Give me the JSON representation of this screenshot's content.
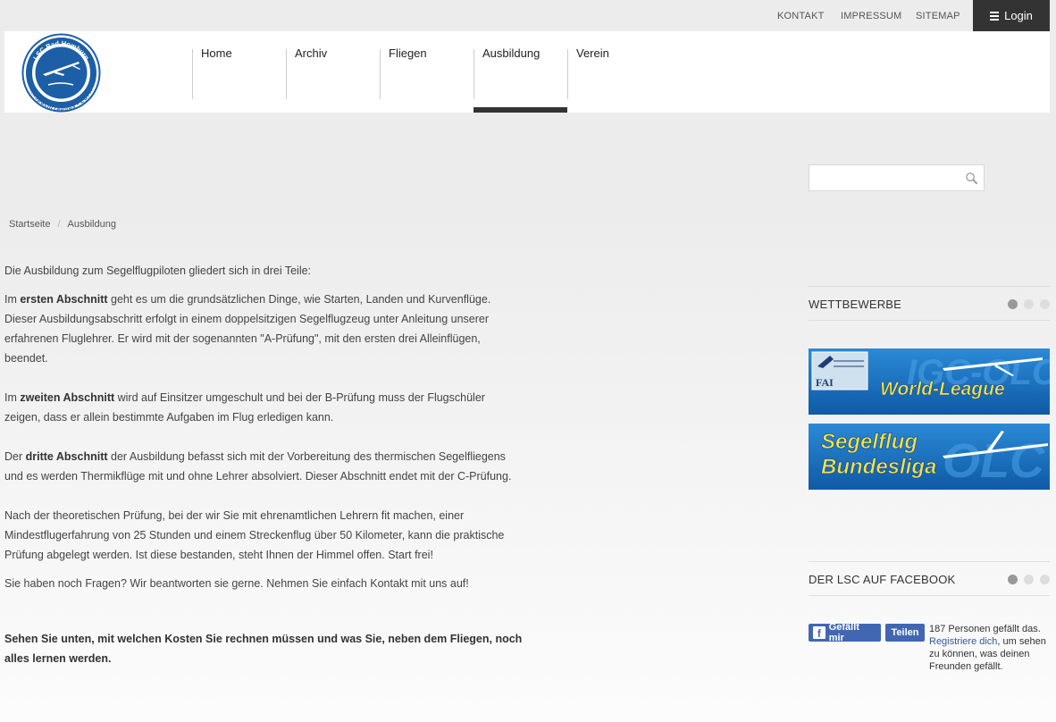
{
  "utility_links": [
    "KONTAKT",
    "IMPRESSUM",
    "SITEMAP"
  ],
  "login": {
    "label": "Login",
    "icon": "menu-icon"
  },
  "logo": {
    "top_text": "LSC Bad Homburg",
    "bottom_text": "Anspach/Taunus - EDFA",
    "icon": "glider-icon"
  },
  "nav": [
    "Home",
    "Archiv",
    "Fliegen",
    "Ausbildung",
    "Verein"
  ],
  "nav_active": "Ausbildung",
  "search": {
    "placeholder": "",
    "icon": "search-icon"
  },
  "breadcrumb": {
    "items": [
      "Startseite",
      "Ausbildung"
    ],
    "separator": "/"
  },
  "content": {
    "intro": "Die Ausbildung zum Segelflugpiloten gliedert sich in drei Teile:",
    "p1_a": "Im ",
    "p1_bold": "ersten Abschnitt",
    "p1_b": " geht es um die grundsätzlichen Dinge, wie Starten, Landen und Kurvenflüge. Dieser Ausbildungsabschritt erfolgt in einem doppelsitzigen Segelflugzeug unter Anleitung unserer erfahrenen Fluglehrer. Er wird mit der sogenannten \"A-Prüfung\", mit den ersten drei Alleinflügen, beendet.",
    "p2_a": "Im ",
    "p2_bold": "zweiten Abschnitt",
    "p2_b": " wird auf Einsitzer umgeschult und bei der B-Prüfung muss der Flugschüler zeigen, dass er allein bestimmte Aufgaben im Flug erledigen kann.",
    "p3_a": "Der ",
    "p3_bold": "dritte Abschnitt",
    "p3_b": " der Ausbildung befasst sich mit der Vorbereitung des thermischen Segelfliegens und es werden Thermikflüge mit und ohne Lehrer absolviert. Dieser Abschnitt endet mit der C-Prüfung.",
    "p4": "Nach der theoretischen Prüfung, bei der wir Sie mit ehrenamtlichen Lehrern fit machen, einer Mindestflugerfahrung von 25 Stunden und einem Streckenflug über 50 Kilometer, kann die praktische Prüfung abgelegt werden. Ist diese bestanden, steht Ihnen der Himmel offen. Start frei!",
    "p5": "Sie haben noch Fragen? Wir beantworten sie gerne. Nehmen Sie einfach Kontakt mit uns auf!",
    "p6_bold": "Sehen Sie unten, mit welchen Kosten Sie rechnen müssen und was Sie, neben dem Fliegen, noch alles lernen werden."
  },
  "widgets": {
    "wettbewerbe": {
      "title": "WETTBEWERBE",
      "banner1": {
        "badge": "FAI",
        "text": "World-League",
        "bg_text": "IGC-OLC"
      },
      "banner2": {
        "line1": "Segelflug",
        "line2": "Bundesliga",
        "bg_text": "OLC"
      }
    },
    "facebook": {
      "title": "DER LSC AUF FACEBOOK",
      "like_label": "Gefällt mir",
      "share_label": "Teilen",
      "count_text": "187 Personen gefällt das.",
      "register_link": "Registriere dich",
      "register_rest": ", um sehen zu können, was deinen Freunden gefällt."
    }
  },
  "colors": {
    "dark": "#333333",
    "fb_blue": "#4267b2",
    "banner_blue": "#1b79c4",
    "banner_yellow": "#f2e24a",
    "logo_blue": "#1d5fa6"
  }
}
